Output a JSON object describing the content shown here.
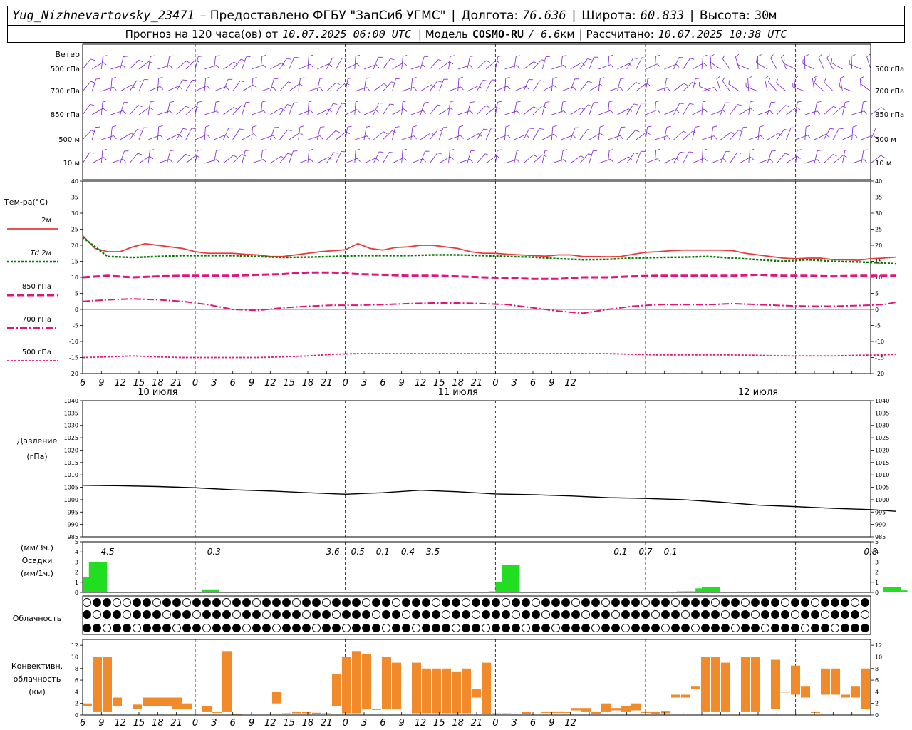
{
  "header": {
    "station": "Yug_Nizhnevartovsky_23471",
    "provider": "– Предоставлено ФГБУ \"ЗапСиб УГМС\"",
    "lon_label": "Долгота:",
    "lon": "76.636",
    "lat_label": "Широта:",
    "lat": "60.833",
    "alt_label": "Высота:",
    "alt": "30м",
    "forecast_prefix": "Прогноз на 120 часа(ов) от",
    "forecast_time": "10.07.2025 06:00 UTC",
    "model_label": "| Модель",
    "model": "COSMO-RU",
    "resolution": "/ 6.6",
    "resolution_unit": "км",
    "calc_label": "| Рассчитано:",
    "calc_time": "10.07.2025 10:38 UTC"
  },
  "labels": {
    "wind_title": "Ветер",
    "wind_levels": [
      "500 гПа",
      "700 гПа",
      "850 гПа",
      "500 м",
      "10 м"
    ],
    "temp_title": "Тем-ра(°С)",
    "temp_legend": [
      "2м",
      "Td 2м",
      "850 гПа",
      "700 гПа",
      "500 гПа"
    ],
    "pressure_title": "Давление",
    "pressure_unit": "(гПа)",
    "precip_unit_top": "(мм/3ч.)",
    "precip_title": "Осадки",
    "precip_unit_bottom": "(мм/1ч.)",
    "cloud_title": "Облачность",
    "conv_title": [
      "Конвективн.",
      "облачность",
      "(км)"
    ],
    "dates": [
      "10 июля",
      "11 июля",
      "12 июля"
    ],
    "hour_ticks": [
      "6",
      "9",
      "12",
      "15",
      "18",
      "21",
      "0",
      "3",
      "6",
      "9",
      "12",
      "15",
      "18",
      "21",
      "0",
      "3",
      "6",
      "9",
      "12",
      "15",
      "18",
      "21",
      "0",
      "3",
      "6",
      "9",
      "12"
    ]
  },
  "colors": {
    "t2m": "#e83a3a",
    "td2m": "#007a00",
    "t850": "#e0157a",
    "t700": "#e0157a",
    "t500": "#e0157a",
    "zero_line": "#3030ff",
    "pressure": "#000000",
    "precip": "#22dd22",
    "conv": "#f08a2a",
    "wind": "#7a22cc"
  },
  "chart_data": [
    {
      "type": "line",
      "title": "Тем-ра(°С)",
      "x_unit": "hours from 10.07.2025 06 UTC",
      "ylim": [
        -20,
        40
      ],
      "series": [
        {
          "name": "2м",
          "x": [
            0,
            2,
            4,
            6,
            8,
            10,
            12,
            14,
            16,
            18,
            20,
            22,
            24,
            26,
            28,
            30,
            32,
            34,
            36,
            38,
            40,
            42,
            44,
            46,
            48,
            50,
            52,
            54,
            56,
            58,
            60,
            62,
            64,
            66,
            68,
            70,
            72,
            74,
            76,
            78,
            80,
            82,
            84,
            86,
            88,
            90,
            92,
            94,
            96,
            98,
            100,
            102,
            104,
            106,
            108,
            110,
            112,
            114,
            116,
            118,
            120,
            122,
            124,
            126,
            128,
            130
          ],
          "values": [
            23,
            19,
            18,
            18,
            19.5,
            20.5,
            20,
            19.5,
            19,
            18,
            17.5,
            17.5,
            17.5,
            17.2,
            17,
            16.5,
            16.5,
            17,
            17.5,
            18,
            18.3,
            18.6,
            20.5,
            19,
            18.5,
            19.3,
            19.5,
            20,
            20,
            19.5,
            19,
            18,
            17.5,
            17.5,
            17.2,
            17,
            16.8,
            16.6,
            17,
            17,
            16.5,
            16.5,
            16.4,
            16.5,
            17.2,
            17.8,
            18,
            18.3,
            18.5,
            18.5,
            18.5,
            18.5,
            18.3,
            17.5,
            17,
            16.5,
            16,
            15.8,
            16,
            16,
            15.5,
            15.5,
            15.3,
            15.8,
            16,
            16.3
          ]
        },
        {
          "name": "Td 2м",
          "x": [
            0,
            4,
            8,
            12,
            16,
            20,
            24,
            28,
            32,
            36,
            40,
            44,
            48,
            52,
            56,
            60,
            64,
            68,
            72,
            76,
            80,
            84,
            88,
            92,
            96,
            100,
            104,
            108,
            112,
            116,
            120,
            124,
            128,
            130
          ],
          "values": [
            22.5,
            16.5,
            16.2,
            16.5,
            16.8,
            16.8,
            16.8,
            16.5,
            16.2,
            16.3,
            16.5,
            16.8,
            16.8,
            16.8,
            17,
            17,
            16.8,
            16.5,
            16.3,
            15.8,
            15.5,
            15.6,
            16,
            16.2,
            16.3,
            16.5,
            16,
            15.5,
            15,
            15.5,
            15,
            14.8,
            14.5,
            14.2
          ]
        },
        {
          "name": "850 гПа",
          "x": [
            0,
            4,
            8,
            12,
            16,
            20,
            24,
            28,
            32,
            36,
            40,
            44,
            48,
            52,
            56,
            60,
            64,
            68,
            72,
            76,
            80,
            84,
            88,
            92,
            96,
            100,
            104,
            108,
            112,
            116,
            120,
            124,
            128,
            130
          ],
          "values": [
            10,
            10.5,
            10,
            10.3,
            10.5,
            10.5,
            10.5,
            10.8,
            11,
            11.5,
            11.5,
            11,
            10.8,
            10.5,
            10.5,
            10.3,
            10,
            9.8,
            9.5,
            9.5,
            10,
            10,
            10.3,
            10.5,
            10.5,
            10.5,
            10.5,
            10.8,
            10.5,
            10.5,
            10.3,
            10.5,
            10.5,
            10.5
          ]
        },
        {
          "name": "700 гПа",
          "x": [
            0,
            4,
            8,
            12,
            16,
            20,
            24,
            28,
            32,
            36,
            40,
            44,
            48,
            52,
            56,
            60,
            64,
            68,
            72,
            76,
            80,
            84,
            88,
            92,
            96,
            100,
            104,
            108,
            112,
            116,
            120,
            124,
            128,
            130
          ],
          "values": [
            2.5,
            3,
            3.3,
            3,
            2.5,
            1.5,
            0,
            -0.3,
            0.5,
            1,
            1.3,
            1.3,
            1.5,
            1.8,
            2,
            2,
            1.8,
            1.5,
            0.5,
            -0.5,
            -1.2,
            0,
            1,
            1.5,
            1.5,
            1.5,
            1.8,
            1.5,
            1.2,
            1,
            1,
            1.2,
            1.5,
            2.2
          ]
        },
        {
          "name": "500 гПа",
          "x": [
            0,
            4,
            8,
            12,
            16,
            20,
            24,
            28,
            32,
            36,
            40,
            44,
            48,
            52,
            56,
            60,
            64,
            68,
            72,
            76,
            80,
            84,
            88,
            92,
            96,
            100,
            104,
            108,
            112,
            116,
            120,
            124,
            128,
            130
          ],
          "values": [
            -15,
            -14.8,
            -14.5,
            -14.8,
            -15,
            -15,
            -15,
            -15,
            -14.8,
            -14.5,
            -14,
            -13.8,
            -13.8,
            -13.8,
            -13.8,
            -13.8,
            -13.8,
            -13.8,
            -13.8,
            -13.8,
            -13.8,
            -13.8,
            -14,
            -14.2,
            -14.2,
            -14.2,
            -14.2,
            -14.3,
            -14.5,
            -14.5,
            -14.5,
            -14.3,
            -14.2,
            -14
          ]
        }
      ]
    },
    {
      "type": "line",
      "title": "Давление",
      "ylabel": "(гПа)",
      "ylim": [
        985,
        1040
      ],
      "series": [
        {
          "name": "Давление",
          "x": [
            0,
            6,
            12,
            18,
            24,
            30,
            36,
            42,
            48,
            54,
            60,
            66,
            72,
            78,
            84,
            90,
            96,
            102,
            108,
            114,
            120,
            126,
            130
          ],
          "values": [
            1005.8,
            1005.6,
            1005.3,
            1004.8,
            1004,
            1003.5,
            1002.8,
            1002.2,
            1002.8,
            1003.8,
            1003.2,
            1002.3,
            1002,
            1001.5,
            1000.8,
            1000.5,
            1000,
            999,
            997.8,
            997.2,
            996.5,
            996,
            995.3
          ]
        }
      ]
    },
    {
      "type": "bar",
      "title": "Осадки",
      "ylabel": "(мм/1ч.)",
      "ylim": [
        0,
        5
      ],
      "x": [
        0,
        1,
        2,
        3,
        4,
        5,
        6,
        7,
        8,
        9,
        10,
        11,
        12,
        13,
        14,
        15,
        16,
        17,
        18,
        19,
        20,
        21,
        22,
        23,
        24,
        25,
        26,
        27,
        28,
        29,
        30,
        31,
        32,
        33,
        34,
        35,
        36,
        37,
        38,
        39,
        40,
        41,
        42,
        43,
        44,
        45,
        46,
        47,
        48,
        49,
        50,
        51,
        52,
        53,
        54,
        55,
        56,
        57,
        58,
        59,
        60,
        61,
        62,
        63,
        64,
        65,
        66,
        67,
        68,
        69,
        70,
        71,
        72,
        73,
        74,
        75,
        76,
        77,
        78,
        79,
        80,
        81,
        82,
        83,
        84,
        85,
        86,
        87,
        88,
        89,
        90,
        91,
        92,
        93,
        94,
        95,
        96,
        97,
        98,
        99,
        100,
        101,
        102,
        103,
        104,
        105,
        106,
        107,
        108,
        109,
        110,
        111,
        112,
        113,
        114,
        115,
        116,
        117,
        118,
        119,
        120,
        121,
        122,
        123,
        124,
        125,
        126,
        127,
        128,
        129
      ],
      "values": [
        1.5,
        3,
        0,
        0,
        0,
        0,
        0,
        0,
        0,
        0,
        0,
        0,
        0,
        0,
        0,
        0,
        0,
        0,
        0,
        0.3,
        0,
        0,
        0,
        0,
        0,
        0,
        0,
        0,
        0,
        0,
        0,
        0,
        0,
        0,
        0,
        0,
        0,
        0,
        0,
        0,
        0,
        0,
        0,
        0,
        0,
        0,
        0,
        0,
        0,
        0,
        0,
        0,
        0,
        0,
        0,
        0,
        0,
        0,
        0,
        0,
        0,
        0,
        0,
        0,
        0,
        0.1,
        1,
        2.7,
        0,
        0,
        0,
        0,
        0,
        0,
        0,
        0,
        0,
        0,
        0,
        0,
        0,
        0,
        0,
        0,
        0,
        0,
        0,
        0,
        0,
        0,
        0,
        0,
        0,
        0,
        0,
        0.1,
        0.1,
        0.1,
        0.4,
        0.5,
        0,
        0,
        0,
        0,
        0,
        0,
        0,
        0,
        0,
        0,
        0,
        0,
        0,
        0,
        0,
        0,
        0,
        0,
        0,
        0,
        0,
        0,
        0,
        0,
        0,
        0,
        0,
        0,
        0.5,
        0.2
      ],
      "annotations": [
        {
          "x": 4,
          "label": "4.5"
        },
        {
          "x": 21,
          "label": "0.3"
        },
        {
          "x": 40,
          "label": "3.6"
        },
        {
          "x": 44,
          "label": "0.5"
        },
        {
          "x": 48,
          "label": "0.1"
        },
        {
          "x": 52,
          "label": "0.4"
        },
        {
          "x": 56,
          "label": "3.5"
        },
        {
          "x": 86,
          "label": "0.1"
        },
        {
          "x": 90,
          "label": "0.7"
        },
        {
          "x": 94,
          "label": "0.1"
        },
        {
          "x": 126,
          "label": "0.8"
        }
      ]
    },
    {
      "type": "bar",
      "title": "Конвективн. облачность",
      "ylabel": "(км)",
      "ylim": [
        0,
        13
      ],
      "note": "floating bars: base to top in km",
      "bars": [
        [
          0,
          1.5,
          2
        ],
        [
          1,
          0.5,
          10
        ],
        [
          2,
          0.5,
          10
        ],
        [
          3,
          1.5,
          3
        ],
        [
          5,
          1,
          1.8
        ],
        [
          6,
          1.5,
          3
        ],
        [
          7,
          1.5,
          3
        ],
        [
          8,
          1.5,
          3
        ],
        [
          9,
          1,
          3
        ],
        [
          10,
          1,
          2
        ],
        [
          12,
          0.5,
          1.5
        ],
        [
          13,
          0.5,
          0.5
        ],
        [
          14,
          0.5,
          11
        ],
        [
          15,
          0.1,
          0.2
        ],
        [
          19,
          2,
          4
        ],
        [
          20,
          0.2,
          0.3
        ],
        [
          21,
          0.3,
          0.5
        ],
        [
          22,
          0.3,
          0.5
        ],
        [
          23,
          0.2,
          0.4
        ],
        [
          24,
          0.2,
          0.3
        ],
        [
          25,
          1.5,
          7
        ],
        [
          26,
          0.3,
          10
        ],
        [
          27,
          0.3,
          11
        ],
        [
          28,
          1,
          10.5
        ],
        [
          29,
          1,
          1
        ],
        [
          30,
          1,
          10
        ],
        [
          31,
          1,
          9
        ],
        [
          33,
          0.3,
          9
        ],
        [
          34,
          0.3,
          8
        ],
        [
          35,
          0.3,
          8
        ],
        [
          36,
          0.3,
          8
        ],
        [
          37,
          0.3,
          7.5
        ],
        [
          38,
          0.3,
          8
        ],
        [
          39,
          3,
          4.5
        ],
        [
          40,
          0.2,
          9
        ],
        [
          41,
          0.2,
          0.3
        ],
        [
          42,
          0.2,
          0.3
        ],
        [
          44,
          0.2,
          0.5
        ],
        [
          46,
          0.5,
          0.5
        ],
        [
          47,
          0.5,
          0.5
        ],
        [
          48,
          0.5,
          0.5
        ],
        [
          49,
          0.8,
          1.2
        ],
        [
          50,
          0.5,
          1.2
        ],
        [
          51,
          0.2,
          0.5
        ],
        [
          52,
          0.5,
          2
        ],
        [
          53,
          0.8,
          1.2
        ],
        [
          54,
          0.5,
          1.5
        ],
        [
          55,
          0.8,
          2
        ],
        [
          56,
          0.5,
          0.5
        ],
        [
          57,
          0.2,
          0.5
        ],
        [
          58,
          0.3,
          0.6
        ],
        [
          59,
          3,
          3.5
        ],
        [
          60,
          3,
          3.5
        ],
        [
          61,
          4.5,
          5
        ],
        [
          62,
          0.5,
          10
        ],
        [
          63,
          0.5,
          10
        ],
        [
          64,
          0.5,
          9
        ],
        [
          66,
          0.5,
          10
        ],
        [
          67,
          0.5,
          10
        ],
        [
          69,
          1,
          9.5
        ],
        [
          70,
          4,
          4
        ],
        [
          71,
          3.5,
          8.5
        ],
        [
          72,
          3,
          5
        ],
        [
          73,
          0.5,
          0.5
        ],
        [
          74,
          3.5,
          8
        ],
        [
          75,
          3.5,
          8
        ],
        [
          76,
          3,
          3.5
        ],
        [
          77,
          3,
          5
        ],
        [
          78,
          1,
          8
        ]
      ]
    }
  ]
}
